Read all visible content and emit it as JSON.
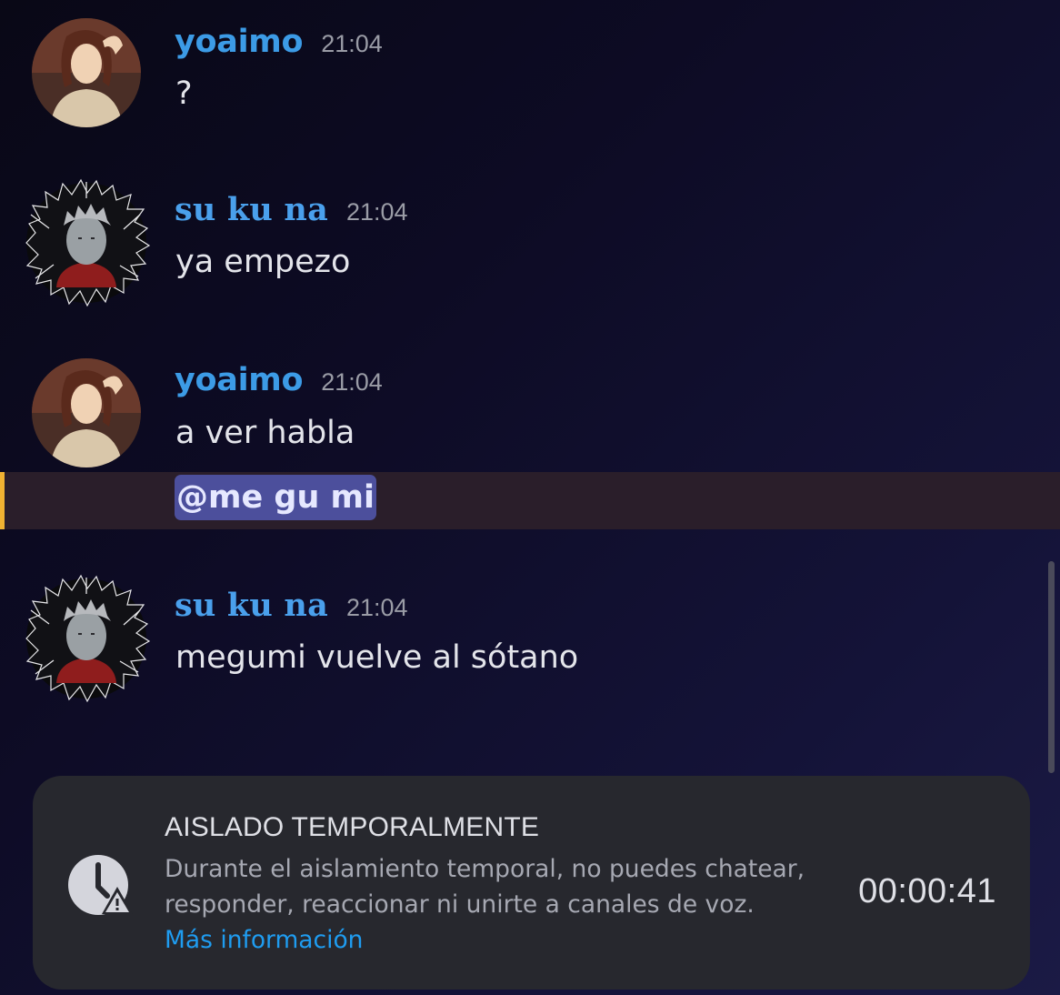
{
  "messages": [
    {
      "author": "yoaimo",
      "time": "21:04",
      "text": "?",
      "avatar": "avatar-brown-hair-woman"
    },
    {
      "author": "su ku na",
      "time": "21:04",
      "text": "ya empezo",
      "avatar": "avatar-tattooed-man-dark-frame"
    },
    {
      "author": "yoaimo",
      "time": "21:04",
      "text": "a ver habla",
      "mention": "@me gu mi",
      "avatar": "avatar-brown-hair-woman"
    },
    {
      "author": "su ku na",
      "time": "21:04",
      "text": "megumi vuelve al sótano",
      "avatar": "avatar-tattooed-man-dark-frame"
    }
  ],
  "timeout": {
    "title": "AISLADO TEMPORALMENTE",
    "description": "Durante el aislamiento temporal, no puedes chatear, responder, reaccionar ni unirte a canales de voz.",
    "link": "Más información",
    "timer": "00:00:41",
    "icon": "clock-warning-icon"
  },
  "colors": {
    "username": "#3c9be6",
    "mention_bg": "#4c4f9c",
    "mention_highlight": "#f0b232",
    "link": "#1f9cf0",
    "card_bg": "#27282e"
  }
}
